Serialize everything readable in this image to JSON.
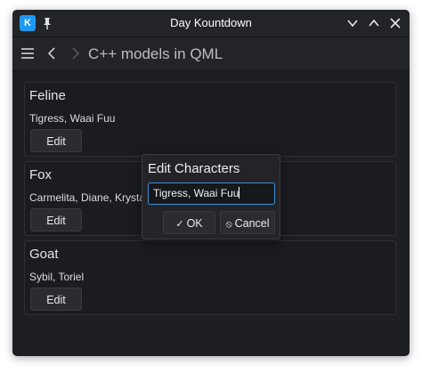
{
  "window": {
    "title": "Day Kountdown",
    "app_icon": "kde-app-icon",
    "pin_icon": "pin-icon"
  },
  "toolbar": {
    "page_title": "C++ models in QML"
  },
  "cards": [
    {
      "title": "Feline",
      "characters": "Tigress, Waai Fuu",
      "edit_label": "Edit"
    },
    {
      "title": "Fox",
      "characters": "Carmelita, Diane, Krysta",
      "edit_label": "Edit"
    },
    {
      "title": "Goat",
      "characters": "Sybil, Toriel",
      "edit_label": "Edit"
    }
  ],
  "dialog": {
    "title": "Edit Characters",
    "input_value": "Tigress, Waai Fuu",
    "ok_label": "OK",
    "cancel_label": "Cancel"
  },
  "colors": {
    "accent": "#3d8fd6",
    "window_bg": "#1e1f23",
    "card_bg": "#1b1c20"
  }
}
